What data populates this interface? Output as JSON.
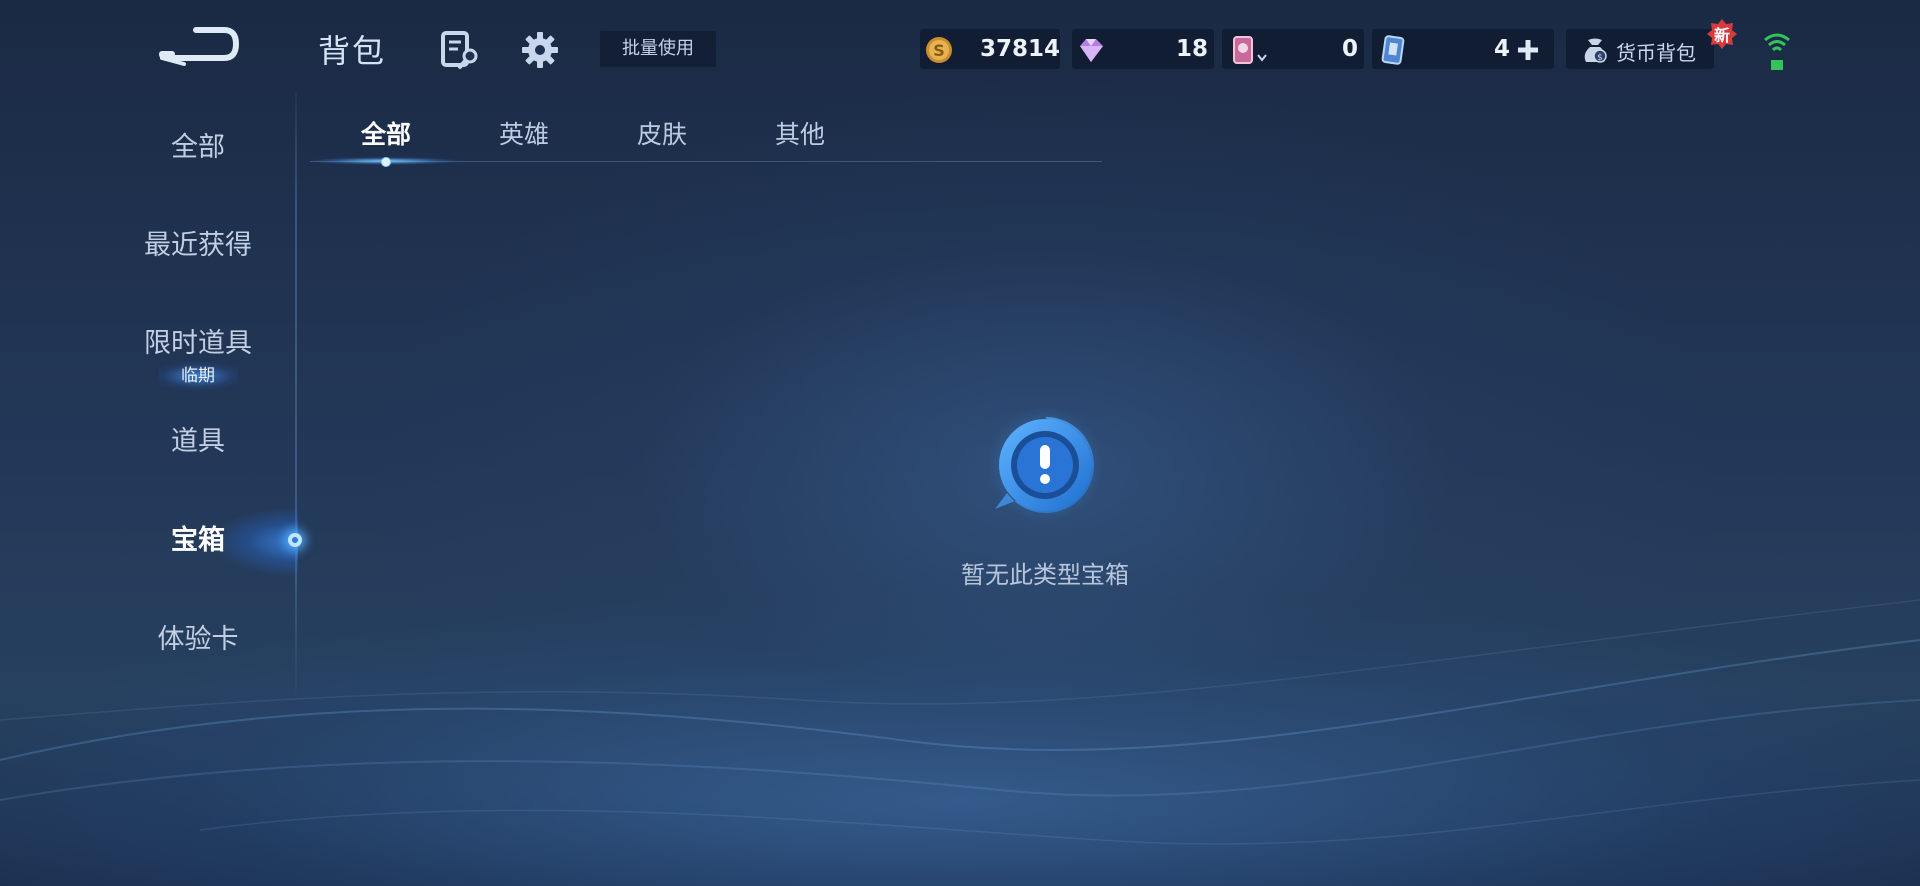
{
  "header": {
    "title": "背包",
    "batch_use_label": "批量使用"
  },
  "resources": [
    {
      "name": "gold-coin",
      "value": "37814",
      "color": "#d9a441"
    },
    {
      "name": "diamond",
      "value": "18",
      "color": "#c58cf0"
    },
    {
      "name": "hero-card",
      "value": "0",
      "color": "#d47aa6"
    },
    {
      "name": "skin-card",
      "value": "4",
      "color": "#6fa6e6"
    }
  ],
  "wallet": {
    "label": "货币背包",
    "badge": "新"
  },
  "sidebar": {
    "items": [
      {
        "label": "全部"
      },
      {
        "label": "最近获得"
      },
      {
        "label": "限时道具",
        "badge": "临期"
      },
      {
        "label": "道具"
      },
      {
        "label": "宝箱",
        "active": true
      },
      {
        "label": "体验卡"
      }
    ]
  },
  "tabs": [
    {
      "label": "全部",
      "active": true
    },
    {
      "label": "英雄"
    },
    {
      "label": "皮肤"
    },
    {
      "label": "其他"
    }
  ],
  "empty_state": {
    "message": "暂无此类型宝箱",
    "icon": "exclamation-icon"
  },
  "theme": {
    "accent": "#3a8ff0",
    "background": "#1e3150"
  }
}
